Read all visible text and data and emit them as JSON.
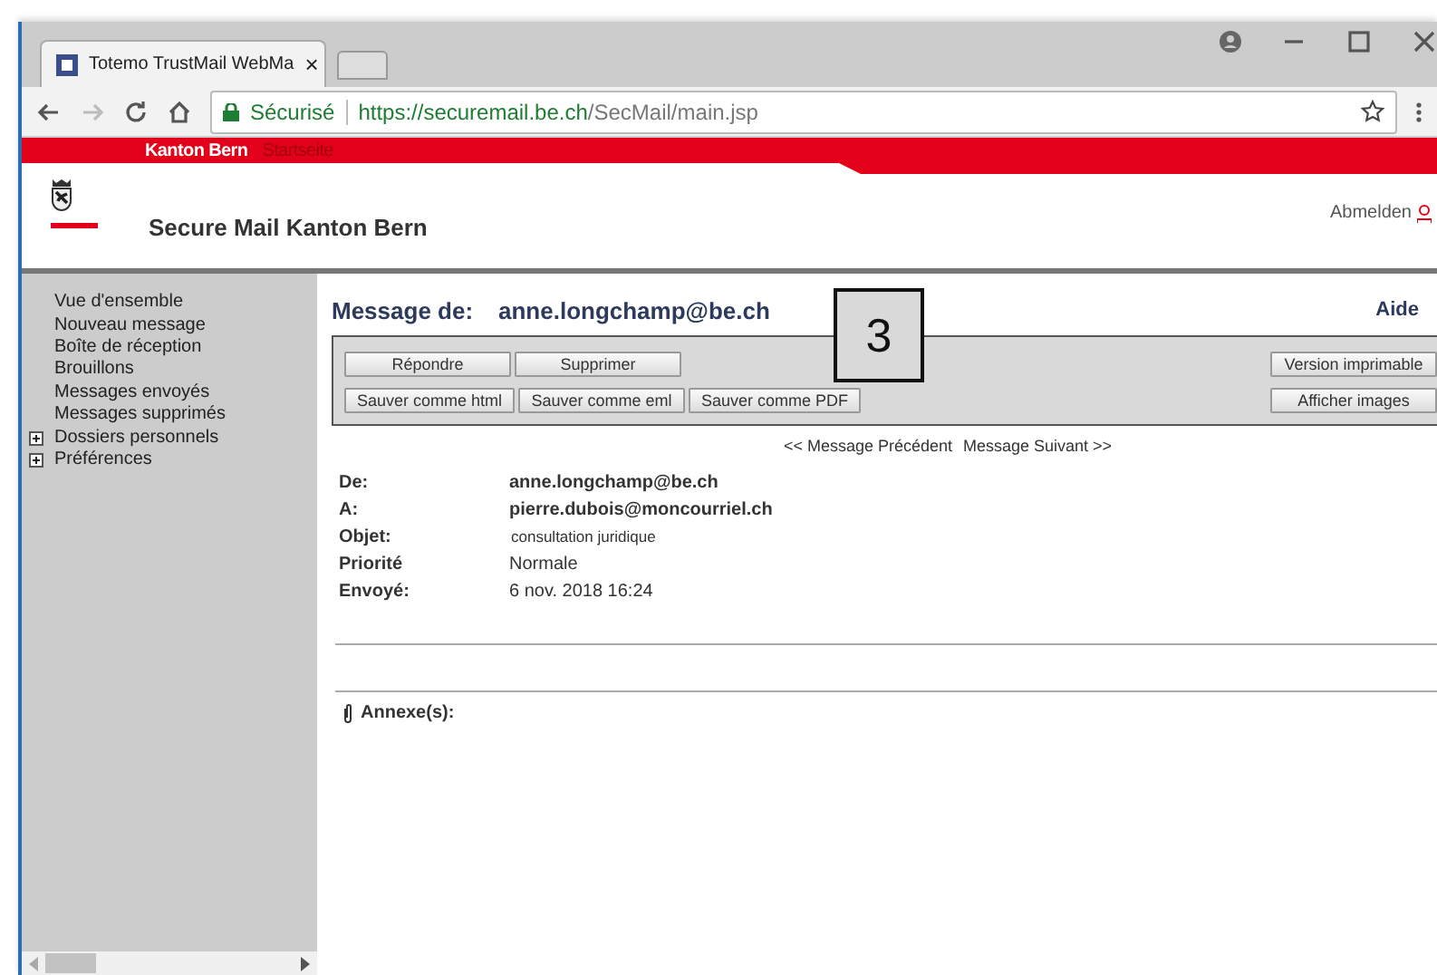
{
  "browser": {
    "tab_title": "Totemo TrustMail WebMa",
    "tab_close": "×",
    "security_label": "Sécurisé",
    "url_host": "https://securemail.be.ch",
    "url_path": "/SecMail/main.jsp"
  },
  "site_nav": [
    {
      "label": "Kanton Bern",
      "selected": true
    },
    {
      "label": "Startseite",
      "selected": false
    }
  ],
  "header": {
    "title": "Secure Mail Kanton Bern",
    "logout": "Abmelden"
  },
  "sidebar": {
    "items": [
      {
        "label": "Vue d'ensemble",
        "expandable": false
      },
      {
        "label": "Nouveau message",
        "expandable": false
      },
      {
        "label": "Boîte de réception",
        "expandable": false
      },
      {
        "label": "Brouillons",
        "expandable": false
      },
      {
        "label": "Messages envoyés",
        "expandable": false
      },
      {
        "label": "Messages supprimés",
        "expandable": false
      },
      {
        "label": "Dossiers personnels",
        "expandable": true
      },
      {
        "label": "Préférences",
        "expandable": true
      }
    ]
  },
  "message": {
    "heading_label": "Message de:",
    "heading_sender": "anne.longchamp@be.ch",
    "help": "Aide",
    "toolbar_left": [
      [
        "Répondre",
        "Supprimer"
      ],
      [
        "Sauver comme html",
        "Sauver comme eml",
        "Sauver comme PDF"
      ]
    ],
    "toolbar_right": [
      "Version imprimable",
      "Afficher images"
    ],
    "prev": "<< Message Précédent",
    "next": "Message Suivant >>",
    "fields": [
      {
        "label": "De:",
        "value": "anne.longchamp@be.ch",
        "kind": "bold"
      },
      {
        "label": "A:",
        "value": "pierre.dubois@moncourriel.ch",
        "kind": "bold"
      },
      {
        "label": "Objet:",
        "value": "consultation juridique",
        "kind": "small"
      },
      {
        "label": "Priorité",
        "value": "Normale",
        "kind": "normal"
      },
      {
        "label": "Envoyé:",
        "value": "6 nov. 2018 16:24",
        "kind": "normal"
      }
    ],
    "attachments_label": "Annexe(s):"
  },
  "callout": "3"
}
